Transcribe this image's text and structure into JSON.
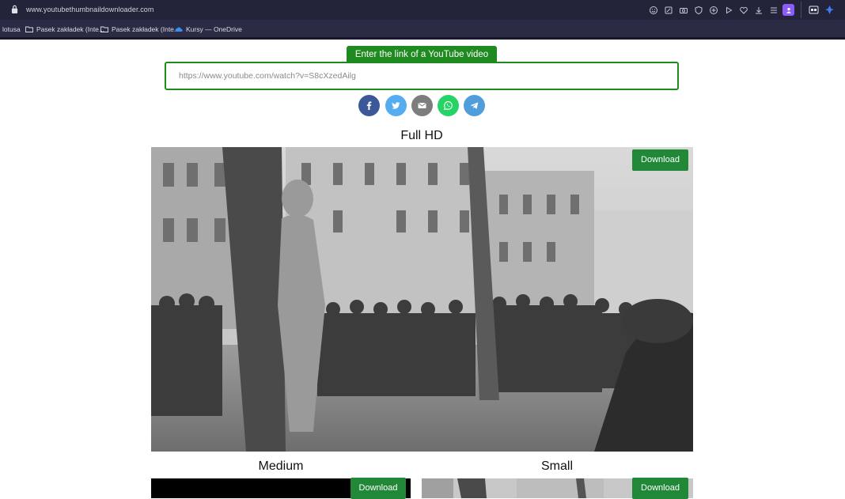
{
  "browser": {
    "url": "www.youtubethumbnaildownloader.com",
    "bookmarks": [
      {
        "label": "lotusa"
      },
      {
        "label": "Pasek zakładek (Inte..."
      },
      {
        "label": "Pasek zakładek (Inte..."
      },
      {
        "label": "Kursy — OneDrive"
      }
    ],
    "toolbar_icons": [
      "emoji-icon",
      "note-icon",
      "camera-icon",
      "shield-icon",
      "translate-icon",
      "play-icon",
      "heart-icon",
      "download-icon",
      "menu-icon",
      "profile-icon",
      "extension-icon",
      "pin-icon"
    ]
  },
  "page": {
    "input_label": "Enter the link of a YouTube video below",
    "input_value": "https://www.youtube.com/watch?v=S8cXzedAilg",
    "share": [
      {
        "name": "facebook",
        "color": "#3b5998"
      },
      {
        "name": "twitter",
        "color": "#55acee"
      },
      {
        "name": "email",
        "color": "#7d7d7d"
      },
      {
        "name": "whatsapp",
        "color": "#25d366"
      },
      {
        "name": "telegram",
        "color": "#4f9edb"
      }
    ],
    "full_hd": {
      "title": "Full HD",
      "download": "Download"
    },
    "medium": {
      "title": "Medium",
      "download": "Download"
    },
    "small": {
      "title": "Small",
      "download": "Download"
    },
    "colors": {
      "green": "#1f8a1f",
      "chrome": "#23233a"
    }
  }
}
